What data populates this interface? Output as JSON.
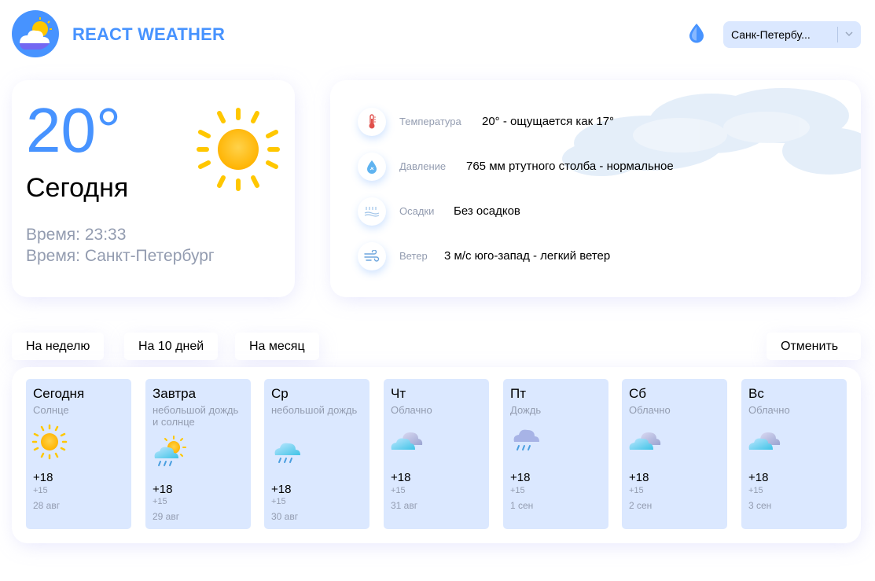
{
  "header": {
    "brand": "REACT WEATHER",
    "city_selected": "Санк-Петербу..."
  },
  "today": {
    "temperature": "20°",
    "label": "Сегодня",
    "time_line": "Время: 23:33",
    "city_line": "Время: Санкт-Петербург"
  },
  "details": [
    {
      "name": "Температура",
      "value": "20° - ощущается как 17°",
      "icon": "thermometer-icon"
    },
    {
      "name": "Давление",
      "value": "765 мм ртутного столба - нормальное",
      "icon": "pressure-icon"
    },
    {
      "name": "Осадки",
      "value": "Без осадков",
      "icon": "precipitation-icon"
    },
    {
      "name": "Ветер",
      "value": "3 м/с юго-запад - легкий ветер",
      "icon": "wind-icon"
    }
  ],
  "tabs": {
    "week": "На неделю",
    "ten_days": "На 10 дней",
    "month": "На месяц",
    "cancel": "Отменить"
  },
  "forecast": [
    {
      "day": "Сегодня",
      "desc": "Солнце",
      "max": "+18",
      "min": "+15",
      "date": "28 авг",
      "icon": "sun-icon"
    },
    {
      "day": "Завтра",
      "desc": "небольшой дождь и солнце",
      "max": "+18",
      "min": "+15",
      "date": "29 авг",
      "icon": "rain-sun-icon"
    },
    {
      "day": "Ср",
      "desc": "небольшой дождь",
      "max": "+18",
      "min": "+15",
      "date": "30 авг",
      "icon": "rain-icon"
    },
    {
      "day": "Чт",
      "desc": "Облачно",
      "max": "+18",
      "min": "+15",
      "date": "31 авг",
      "icon": "cloud-icon"
    },
    {
      "day": "Пт",
      "desc": "Дождь",
      "max": "+18",
      "min": "+15",
      "date": "1 сен",
      "icon": "rain-icon"
    },
    {
      "day": "Сб",
      "desc": "Облачно",
      "max": "+18",
      "min": "+15",
      "date": "2 сен",
      "icon": "cloud-icon"
    },
    {
      "day": "Вс",
      "desc": "Облачно",
      "max": "+18",
      "min": "+15",
      "date": "3 сен",
      "icon": "cloud-icon"
    }
  ],
  "colors": {
    "accent": "#4793ff",
    "card_day_bg": "#dbe8ff",
    "muted_text": "#939cb0",
    "sun": "#ffc700"
  }
}
